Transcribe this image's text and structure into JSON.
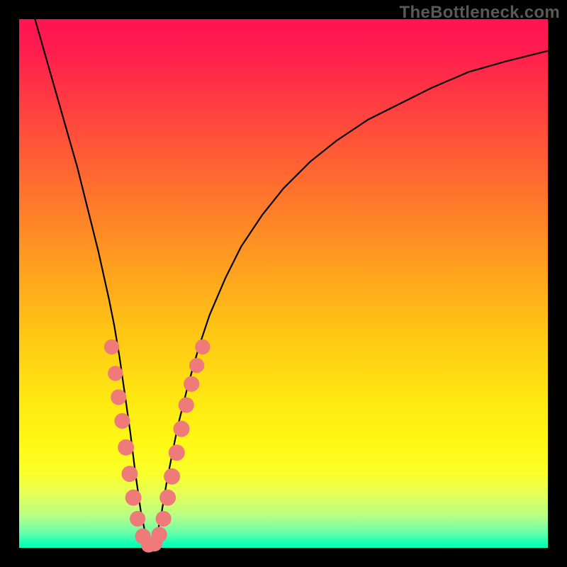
{
  "watermark": "TheBottleneck.com",
  "colors": {
    "frame": "#000000",
    "curve": "#000000",
    "markers": "#ee7a7a",
    "gradient_top": "#ff1453",
    "gradient_bottom": "#00ffb9"
  },
  "chart_data": {
    "type": "line",
    "title": "",
    "xlabel": "",
    "ylabel": "",
    "xlim": [
      0,
      100
    ],
    "ylim": [
      0,
      100
    ],
    "note": "Axes are normalized 0–100; no numeric ticks are shown in the source image. Values are estimated from pixel positions.",
    "series": [
      {
        "name": "bottleneck-curve",
        "x": [
          3,
          5,
          7,
          9,
          11,
          13,
          15,
          17,
          18,
          19,
          20,
          21,
          22,
          23,
          24,
          25,
          26,
          27,
          28,
          30,
          32,
          34,
          36,
          39,
          42,
          46,
          50,
          55,
          60,
          66,
          72,
          78,
          85,
          92,
          100
        ],
        "y": [
          100,
          93,
          86,
          79,
          72,
          64,
          56,
          47,
          42,
          36,
          29,
          22,
          14,
          7,
          2,
          0,
          2,
          7,
          13,
          23,
          31,
          38,
          44,
          51,
          57,
          63,
          68,
          73,
          77,
          81,
          84,
          87,
          90,
          92,
          94
        ]
      }
    ],
    "markers": {
      "name": "highlighted-points",
      "points": [
        {
          "x": 17.5,
          "y": 38,
          "r": 1.5
        },
        {
          "x": 18.2,
          "y": 33,
          "r": 1.5
        },
        {
          "x": 18.8,
          "y": 28.5,
          "r": 1.6
        },
        {
          "x": 19.5,
          "y": 24,
          "r": 1.6
        },
        {
          "x": 20.2,
          "y": 19,
          "r": 1.7
        },
        {
          "x": 20.9,
          "y": 14,
          "r": 1.7
        },
        {
          "x": 21.6,
          "y": 9.5,
          "r": 1.7
        },
        {
          "x": 22.4,
          "y": 5.5,
          "r": 1.6
        },
        {
          "x": 23.4,
          "y": 2.2,
          "r": 1.6
        },
        {
          "x": 24.5,
          "y": 0.6,
          "r": 1.6
        },
        {
          "x": 25.6,
          "y": 0.8,
          "r": 1.6
        },
        {
          "x": 26.5,
          "y": 2.5,
          "r": 1.6
        },
        {
          "x": 27.3,
          "y": 5.5,
          "r": 1.6
        },
        {
          "x": 28.1,
          "y": 9.5,
          "r": 1.7
        },
        {
          "x": 28.9,
          "y": 13.5,
          "r": 1.7
        },
        {
          "x": 29.8,
          "y": 18,
          "r": 1.7
        },
        {
          "x": 30.7,
          "y": 22.5,
          "r": 1.7
        },
        {
          "x": 31.6,
          "y": 27,
          "r": 1.6
        },
        {
          "x": 32.6,
          "y": 31,
          "r": 1.6
        },
        {
          "x": 33.6,
          "y": 34.5,
          "r": 1.5
        },
        {
          "x": 34.7,
          "y": 38,
          "r": 1.5
        }
      ]
    }
  }
}
